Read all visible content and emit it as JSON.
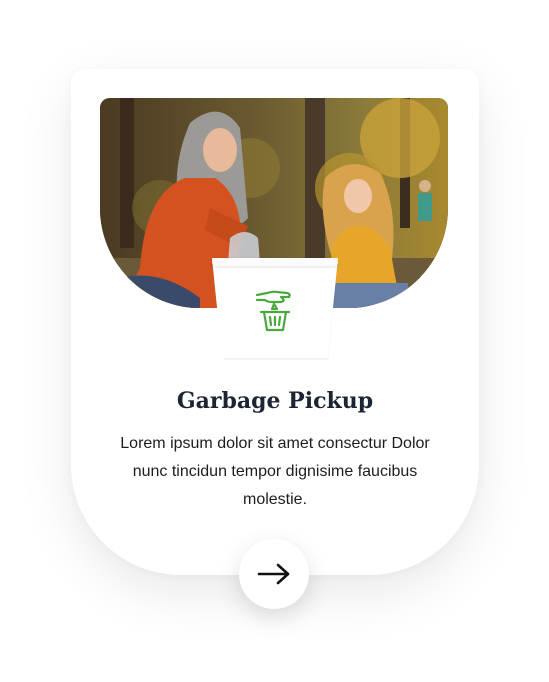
{
  "card": {
    "title": "Garbage Pickup",
    "description": "Lorem ipsum dolor sit amet consectur Dolor nunc tincidun tempor dignisime faucibus molestie.",
    "image_alt": "photo-woman-and-girl-picking-up-garbage",
    "service_icon": "hand-dropping-trash-into-bin-icon",
    "action_icon": "arrow-right-icon"
  },
  "colors": {
    "accent_green": "#4aa83e",
    "title": "#1d2433",
    "text": "#1d1d1d",
    "background": "#ffffff"
  }
}
